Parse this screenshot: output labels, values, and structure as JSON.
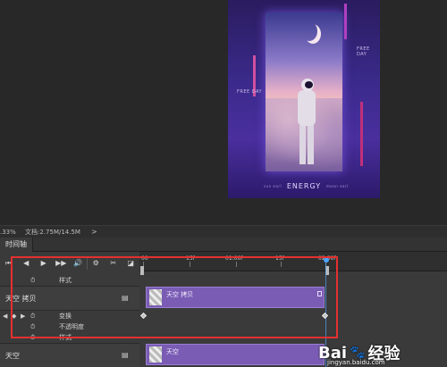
{
  "status_bar": {
    "zoom": ".33%",
    "doc_size": "文档:2.75M/14.5M",
    "arrow": ">"
  },
  "panel": {
    "tab_label": "时间轴"
  },
  "poster": {
    "free_day_1": "FREE DAY",
    "free_day_2": "FREE DAY",
    "title": "ENERGY",
    "sub_left": "sun earl",
    "sub_right": "moon earl"
  },
  "timeline": {
    "controls": [
      "⏮",
      "◀",
      "▶",
      "▶▶",
      "🔊",
      "⚙",
      "✂",
      "◪"
    ],
    "ruler_labels": [
      "00",
      "15f",
      "01:00f",
      "15f",
      "02:00f"
    ],
    "rows": {
      "style_top": "样式",
      "layer_copy": "天空 拷贝",
      "transform": "变换",
      "opacity": "不透明度",
      "style_bottom": "样式",
      "layer_sky": "天空"
    },
    "clips": {
      "copy_title": "天空 拷贝",
      "sky_title": "天空"
    }
  },
  "watermark": {
    "logo": "Bai",
    "logo2": "经验",
    "url": "jingyan.baidu.com"
  },
  "colors": {
    "highlight": "#e53030",
    "clip": "#7a5cb4",
    "playhead": "#4aa3ff"
  }
}
